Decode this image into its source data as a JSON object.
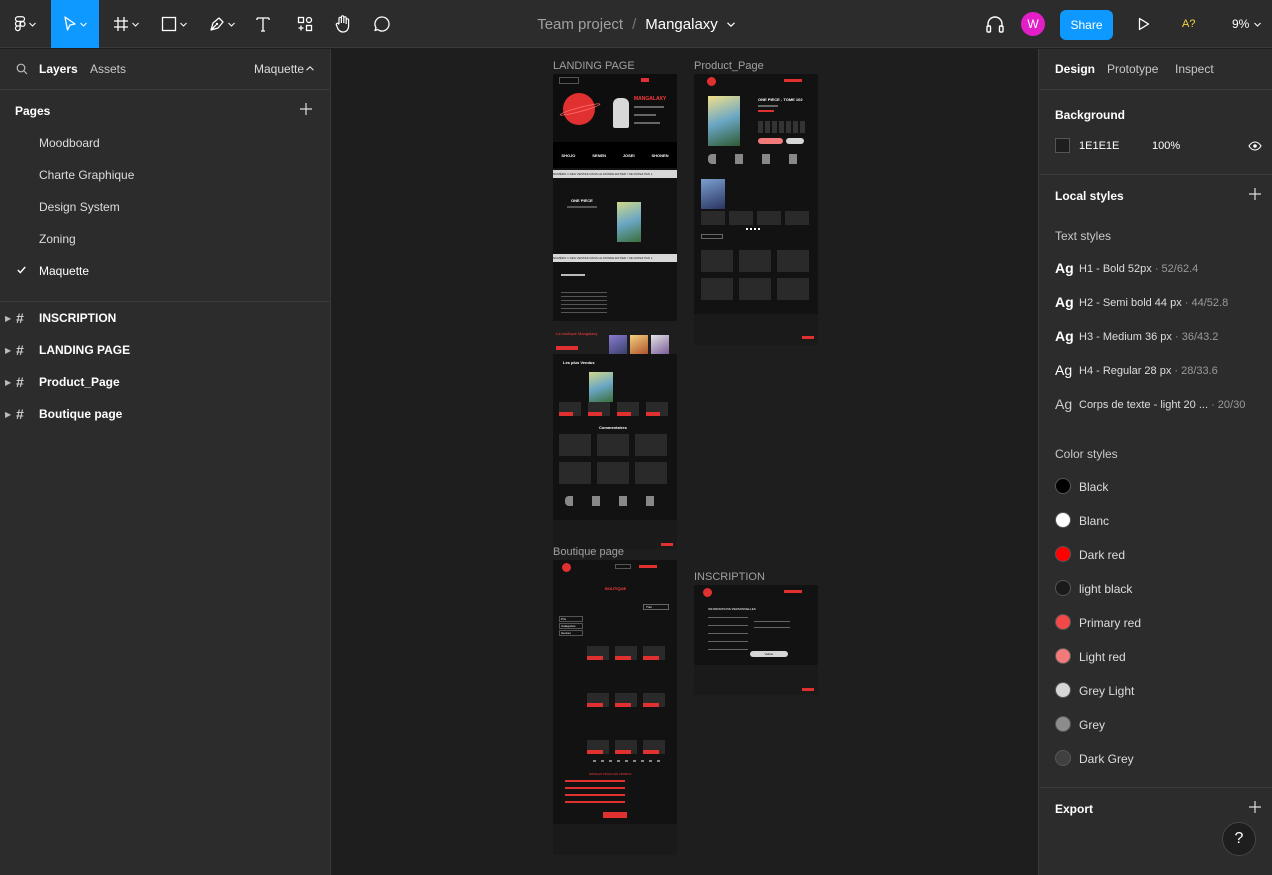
{
  "toolbar": {
    "team": "Team project",
    "separator": "/",
    "file": "Mangalaxy",
    "avatar_letter": "W",
    "share_label": "Share",
    "a11y": "A?",
    "zoom": "9%"
  },
  "left_panel": {
    "tab_layers": "Layers",
    "tab_assets": "Assets",
    "page_switch": "Maquette",
    "pages_header": "Pages",
    "pages": [
      "Moodboard",
      "Charte Graphique",
      "Design System",
      "Zoning",
      "Maquette"
    ],
    "active_page_index": 4,
    "layers": [
      "INSCRIPTION",
      "LANDING PAGE",
      "Product_Page",
      "Boutique page"
    ]
  },
  "canvas": {
    "frames": [
      {
        "label": "LANDING PAGE"
      },
      {
        "label": "Product_Page"
      },
      {
        "label": "Boutique page"
      },
      {
        "label": "INSCRIPTION"
      }
    ],
    "landing": {
      "brand": "MANGALAXY",
      "categories": [
        "SHOJO",
        "SENEN",
        "JOSEI",
        "SHONEN"
      ],
      "banner": "NUMÉRO 1 DES VENTES DANS LE MONDE ENTIER ! NE RATEZ PAS L",
      "feature_title": "ONE PIECE",
      "shop_title": "La boutique Mangalaxy",
      "bestsellers": "Les plus Vendus",
      "comments": "Commentaires"
    },
    "product": {
      "title": "ONE PIECE - TOME 102"
    },
    "boutique": {
      "title": "BOUTIQUE",
      "sort": "Trier",
      "filters": [
        "Prix",
        "Catégories",
        "Genres"
      ],
      "perks_title": "MANGAS POUR LES VENDUS"
    },
    "inscription": {
      "title": "INFORMATIONS PERSONNELLES",
      "submit": "Valider"
    }
  },
  "right_panel": {
    "tabs": [
      "Design",
      "Prototype",
      "Inspect"
    ],
    "background_header": "Background",
    "background_hex": "1E1E1E",
    "background_opacity": "100%",
    "local_styles": "Local styles",
    "text_styles_header": "Text styles",
    "text_styles": [
      {
        "name": "H1 - Bold 52px",
        "meta": " · 52/62.4"
      },
      {
        "name": "H2 - Semi bold 44 px",
        "meta": " · 44/52.8"
      },
      {
        "name": "H3 - Medium 36 px",
        "meta": " · 36/43.2"
      },
      {
        "name": "H4 - Regular 28 px",
        "meta": " · 28/33.6"
      },
      {
        "name": "Corps de texte - light 20 ...",
        "meta": " · 20/30"
      }
    ],
    "color_styles_header": "Color styles",
    "color_styles": [
      {
        "name": "Black",
        "color": "#000000"
      },
      {
        "name": "Blanc",
        "color": "#ffffff"
      },
      {
        "name": "Dark red",
        "color": "#ff0000"
      },
      {
        "name": "light black",
        "color": "#1a1a1a"
      },
      {
        "name": "Primary red",
        "color": "#f24848"
      },
      {
        "name": "Light red",
        "color": "#f27a7a"
      },
      {
        "name": "Grey Light",
        "color": "#d6d6d6"
      },
      {
        "name": "Grey",
        "color": "#8c8c8c"
      },
      {
        "name": "Dark Grey",
        "color": "#404040"
      }
    ],
    "export_header": "Export",
    "help": "?"
  }
}
